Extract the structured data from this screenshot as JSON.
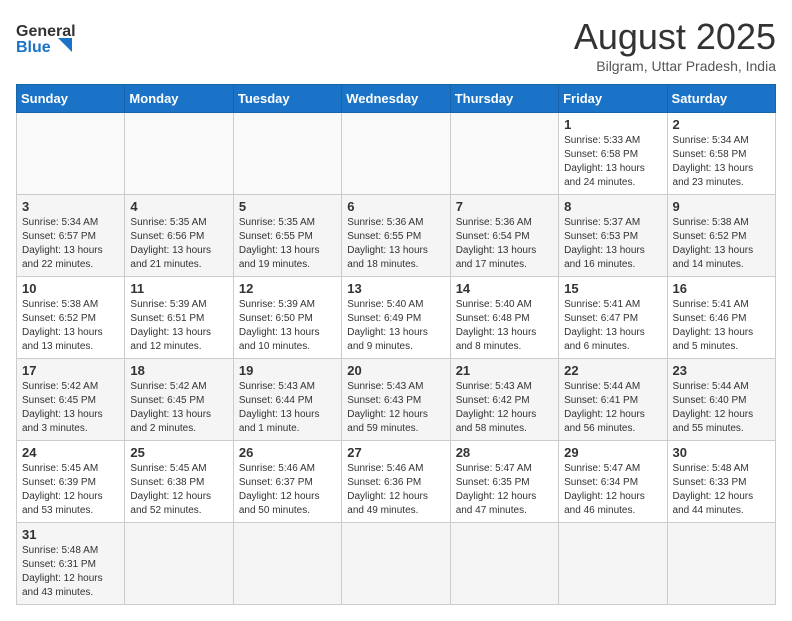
{
  "header": {
    "logo_general": "General",
    "logo_blue": "Blue",
    "month_title": "August 2025",
    "subtitle": "Bilgram, Uttar Pradesh, India"
  },
  "days_of_week": [
    "Sunday",
    "Monday",
    "Tuesday",
    "Wednesday",
    "Thursday",
    "Friday",
    "Saturday"
  ],
  "weeks": [
    [
      {
        "day": null,
        "info": null
      },
      {
        "day": null,
        "info": null
      },
      {
        "day": null,
        "info": null
      },
      {
        "day": null,
        "info": null
      },
      {
        "day": null,
        "info": null
      },
      {
        "day": "1",
        "info": "Sunrise: 5:33 AM\nSunset: 6:58 PM\nDaylight: 13 hours and 24 minutes."
      },
      {
        "day": "2",
        "info": "Sunrise: 5:34 AM\nSunset: 6:58 PM\nDaylight: 13 hours and 23 minutes."
      }
    ],
    [
      {
        "day": "3",
        "info": "Sunrise: 5:34 AM\nSunset: 6:57 PM\nDaylight: 13 hours and 22 minutes."
      },
      {
        "day": "4",
        "info": "Sunrise: 5:35 AM\nSunset: 6:56 PM\nDaylight: 13 hours and 21 minutes."
      },
      {
        "day": "5",
        "info": "Sunrise: 5:35 AM\nSunset: 6:55 PM\nDaylight: 13 hours and 19 minutes."
      },
      {
        "day": "6",
        "info": "Sunrise: 5:36 AM\nSunset: 6:55 PM\nDaylight: 13 hours and 18 minutes."
      },
      {
        "day": "7",
        "info": "Sunrise: 5:36 AM\nSunset: 6:54 PM\nDaylight: 13 hours and 17 minutes."
      },
      {
        "day": "8",
        "info": "Sunrise: 5:37 AM\nSunset: 6:53 PM\nDaylight: 13 hours and 16 minutes."
      },
      {
        "day": "9",
        "info": "Sunrise: 5:38 AM\nSunset: 6:52 PM\nDaylight: 13 hours and 14 minutes."
      }
    ],
    [
      {
        "day": "10",
        "info": "Sunrise: 5:38 AM\nSunset: 6:52 PM\nDaylight: 13 hours and 13 minutes."
      },
      {
        "day": "11",
        "info": "Sunrise: 5:39 AM\nSunset: 6:51 PM\nDaylight: 13 hours and 12 minutes."
      },
      {
        "day": "12",
        "info": "Sunrise: 5:39 AM\nSunset: 6:50 PM\nDaylight: 13 hours and 10 minutes."
      },
      {
        "day": "13",
        "info": "Sunrise: 5:40 AM\nSunset: 6:49 PM\nDaylight: 13 hours and 9 minutes."
      },
      {
        "day": "14",
        "info": "Sunrise: 5:40 AM\nSunset: 6:48 PM\nDaylight: 13 hours and 8 minutes."
      },
      {
        "day": "15",
        "info": "Sunrise: 5:41 AM\nSunset: 6:47 PM\nDaylight: 13 hours and 6 minutes."
      },
      {
        "day": "16",
        "info": "Sunrise: 5:41 AM\nSunset: 6:46 PM\nDaylight: 13 hours and 5 minutes."
      }
    ],
    [
      {
        "day": "17",
        "info": "Sunrise: 5:42 AM\nSunset: 6:45 PM\nDaylight: 13 hours and 3 minutes."
      },
      {
        "day": "18",
        "info": "Sunrise: 5:42 AM\nSunset: 6:45 PM\nDaylight: 13 hours and 2 minutes."
      },
      {
        "day": "19",
        "info": "Sunrise: 5:43 AM\nSunset: 6:44 PM\nDaylight: 13 hours and 1 minute."
      },
      {
        "day": "20",
        "info": "Sunrise: 5:43 AM\nSunset: 6:43 PM\nDaylight: 12 hours and 59 minutes."
      },
      {
        "day": "21",
        "info": "Sunrise: 5:43 AM\nSunset: 6:42 PM\nDaylight: 12 hours and 58 minutes."
      },
      {
        "day": "22",
        "info": "Sunrise: 5:44 AM\nSunset: 6:41 PM\nDaylight: 12 hours and 56 minutes."
      },
      {
        "day": "23",
        "info": "Sunrise: 5:44 AM\nSunset: 6:40 PM\nDaylight: 12 hours and 55 minutes."
      }
    ],
    [
      {
        "day": "24",
        "info": "Sunrise: 5:45 AM\nSunset: 6:39 PM\nDaylight: 12 hours and 53 minutes."
      },
      {
        "day": "25",
        "info": "Sunrise: 5:45 AM\nSunset: 6:38 PM\nDaylight: 12 hours and 52 minutes."
      },
      {
        "day": "26",
        "info": "Sunrise: 5:46 AM\nSunset: 6:37 PM\nDaylight: 12 hours and 50 minutes."
      },
      {
        "day": "27",
        "info": "Sunrise: 5:46 AM\nSunset: 6:36 PM\nDaylight: 12 hours and 49 minutes."
      },
      {
        "day": "28",
        "info": "Sunrise: 5:47 AM\nSunset: 6:35 PM\nDaylight: 12 hours and 47 minutes."
      },
      {
        "day": "29",
        "info": "Sunrise: 5:47 AM\nSunset: 6:34 PM\nDaylight: 12 hours and 46 minutes."
      },
      {
        "day": "30",
        "info": "Sunrise: 5:48 AM\nSunset: 6:33 PM\nDaylight: 12 hours and 44 minutes."
      }
    ],
    [
      {
        "day": "31",
        "info": "Sunrise: 5:48 AM\nSunset: 6:31 PM\nDaylight: 12 hours and 43 minutes."
      },
      {
        "day": null,
        "info": null
      },
      {
        "day": null,
        "info": null
      },
      {
        "day": null,
        "info": null
      },
      {
        "day": null,
        "info": null
      },
      {
        "day": null,
        "info": null
      },
      {
        "day": null,
        "info": null
      }
    ]
  ]
}
